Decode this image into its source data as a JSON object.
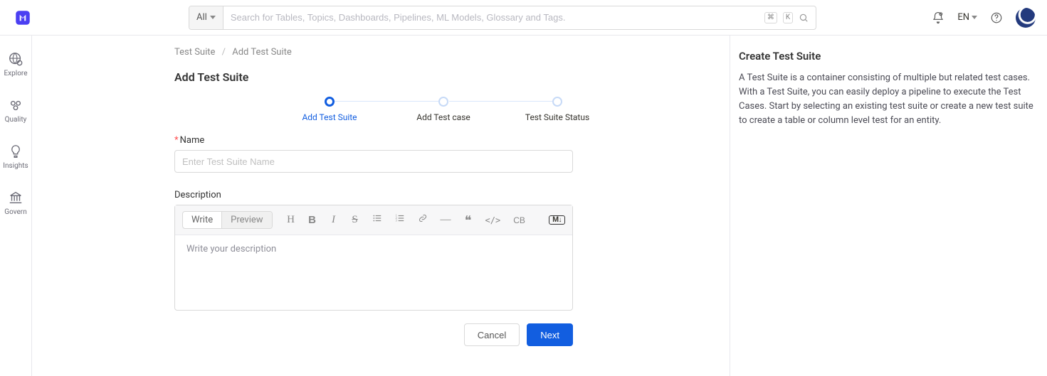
{
  "header": {
    "search_filter": "All",
    "search_placeholder": "Search for Tables, Topics, Dashboards, Pipelines, ML Models, Glossary and Tags.",
    "lang": "EN",
    "kbd_cmd": "⌘",
    "kbd_k": "K"
  },
  "sidebar": {
    "items": [
      {
        "label": "Explore"
      },
      {
        "label": "Quality"
      },
      {
        "label": "Insights"
      },
      {
        "label": "Govern"
      }
    ]
  },
  "breadcrumb": {
    "parent": "Test Suite",
    "current": "Add Test Suite"
  },
  "page_title": "Add Test Suite",
  "steps": [
    {
      "label": "Add Test Suite"
    },
    {
      "label": "Add Test case"
    },
    {
      "label": "Test Suite Status"
    }
  ],
  "form": {
    "name_label": "Name",
    "name_placeholder": "Enter Test Suite Name",
    "name_value": "",
    "desc_label": "Description",
    "desc_placeholder": "Write your description",
    "tab_write": "Write",
    "tab_preview": "Preview",
    "md_label": "M↓",
    "code_block_label": "CB"
  },
  "buttons": {
    "cancel": "Cancel",
    "next": "Next"
  },
  "right": {
    "title": "Create Test Suite",
    "body": "A Test Suite is a container consisting of multiple but related test cases. With a Test Suite, you can easily deploy a pipeline to execute the Test Cases. Start by selecting an existing test suite or create a new test suite to create a table or column level test for an entity."
  }
}
